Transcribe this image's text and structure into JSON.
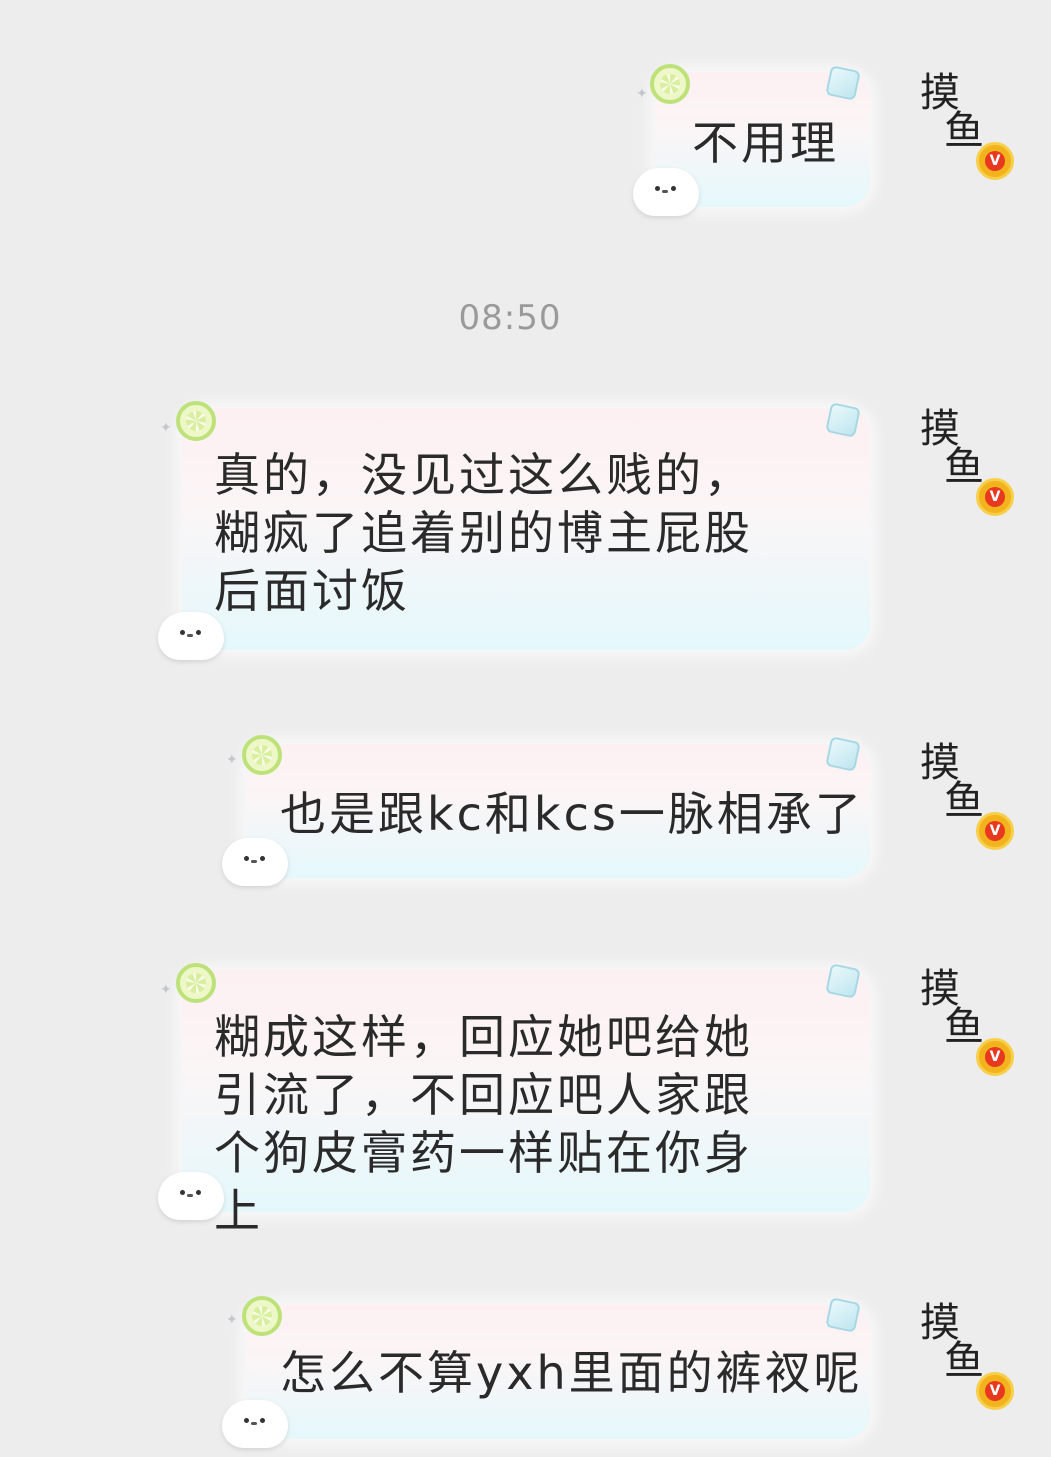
{
  "chat": {
    "timestamp": "08:50",
    "messages": [
      {
        "sender": "self",
        "text": "不用理"
      },
      {
        "sender": "self",
        "text": "真的，没见过这么贱的，糊疯了追着别的博主屁股后面讨饭"
      },
      {
        "sender": "self",
        "text": "也是跟kc和kcs一脉相承了"
      },
      {
        "sender": "self",
        "text": "糊成这样，回应她吧给她引流了，不回应吧人家跟个狗皮膏药一样贴在你身上"
      },
      {
        "sender": "self",
        "text": "怎么不算yxh里面的裤衩呢"
      }
    ]
  },
  "avatar": {
    "glyph_top": "摸",
    "glyph_bottom": "鱼",
    "badge": "V"
  },
  "colors": {
    "background": "#ededed",
    "bubble_top": "#fdf0f2",
    "bubble_bottom": "#e4f8fb",
    "badge": "#e8381f"
  }
}
